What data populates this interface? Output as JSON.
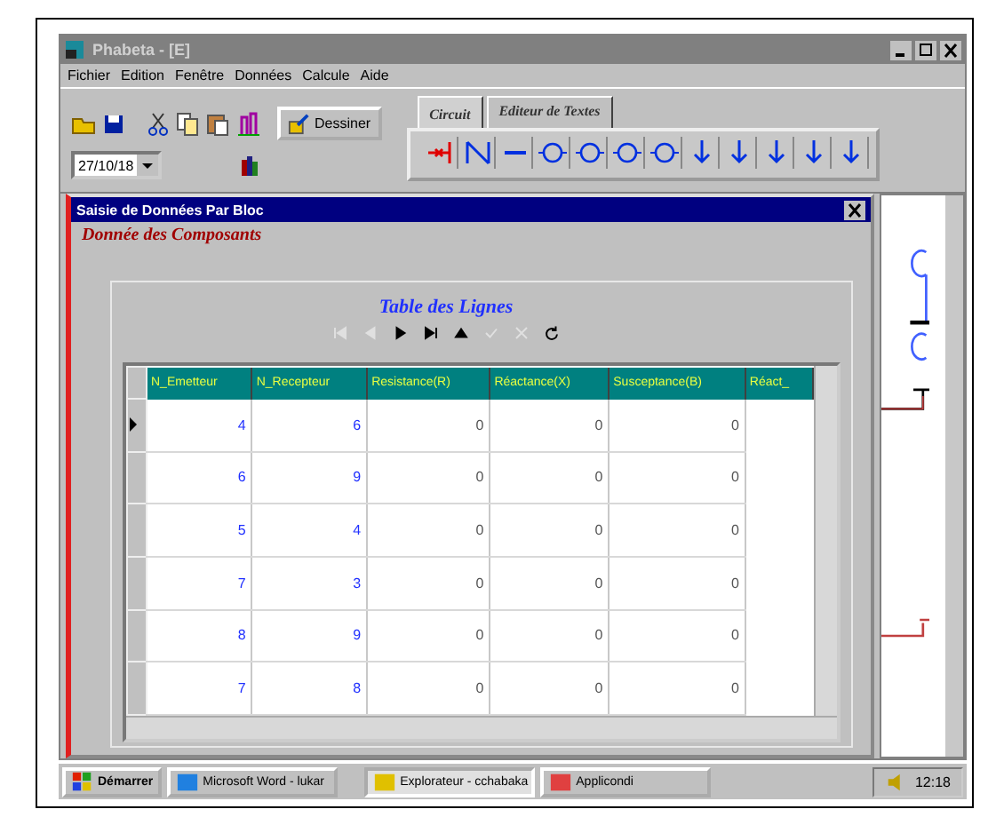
{
  "window": {
    "title": "Phabeta - [E]"
  },
  "menu": [
    "Fichier",
    "Edition",
    "Fenêtre",
    "Données",
    "Calcule",
    "Aide"
  ],
  "toolbar": {
    "date": "27/10/18",
    "draw_button": "Dessiner"
  },
  "tabs": [
    {
      "label": "Circuit",
      "selected": true
    },
    {
      "label": "Editeur de Textes",
      "selected": false
    }
  ],
  "child_window": {
    "title": "Saisie de Données Par Bloc",
    "heading": "Donnée des Composants",
    "table_title": "Table des Lignes",
    "navigator": [
      {
        "kind": "first",
        "disabled": true
      },
      {
        "kind": "prior",
        "disabled": true
      },
      {
        "kind": "next",
        "disabled": false
      },
      {
        "kind": "last",
        "disabled": false
      },
      {
        "kind": "insert",
        "disabled": false
      },
      {
        "kind": "post",
        "disabled": true
      },
      {
        "kind": "cancel",
        "disabled": true
      },
      {
        "kind": "refresh",
        "disabled": false
      }
    ],
    "table": {
      "columns": [
        "N_Emetteur",
        "N_Recepteur",
        "Resistance(R)",
        "Réactance(X)",
        "Susceptance(B)",
        "Réact_"
      ],
      "rows": [
        {
          "cells": [
            "4",
            "6",
            "0",
            "0",
            "0"
          ],
          "selected": true
        },
        {
          "cells": [
            "6",
            "9",
            "0",
            "0",
            "0"
          ],
          "selected": false
        },
        {
          "cells": [
            "5",
            "4",
            "0",
            "0",
            "0"
          ],
          "selected": false
        },
        {
          "cells": [
            "7",
            "3",
            "0",
            "0",
            "0"
          ],
          "selected": false
        },
        {
          "cells": [
            "8",
            "9",
            "0",
            "0",
            "0"
          ],
          "selected": false
        },
        {
          "cells": [
            "7",
            "8",
            "0",
            "0",
            "0"
          ],
          "selected": false
        }
      ]
    }
  },
  "taskbar": {
    "start": "Démarrer",
    "tasks": [
      {
        "label": "Microsoft Word - lukar",
        "selected": false
      },
      {
        "label": "Explorateur - cchabaka",
        "selected": true
      },
      {
        "label": "Applicondi",
        "selected": false
      }
    ],
    "clock": "12:18"
  }
}
